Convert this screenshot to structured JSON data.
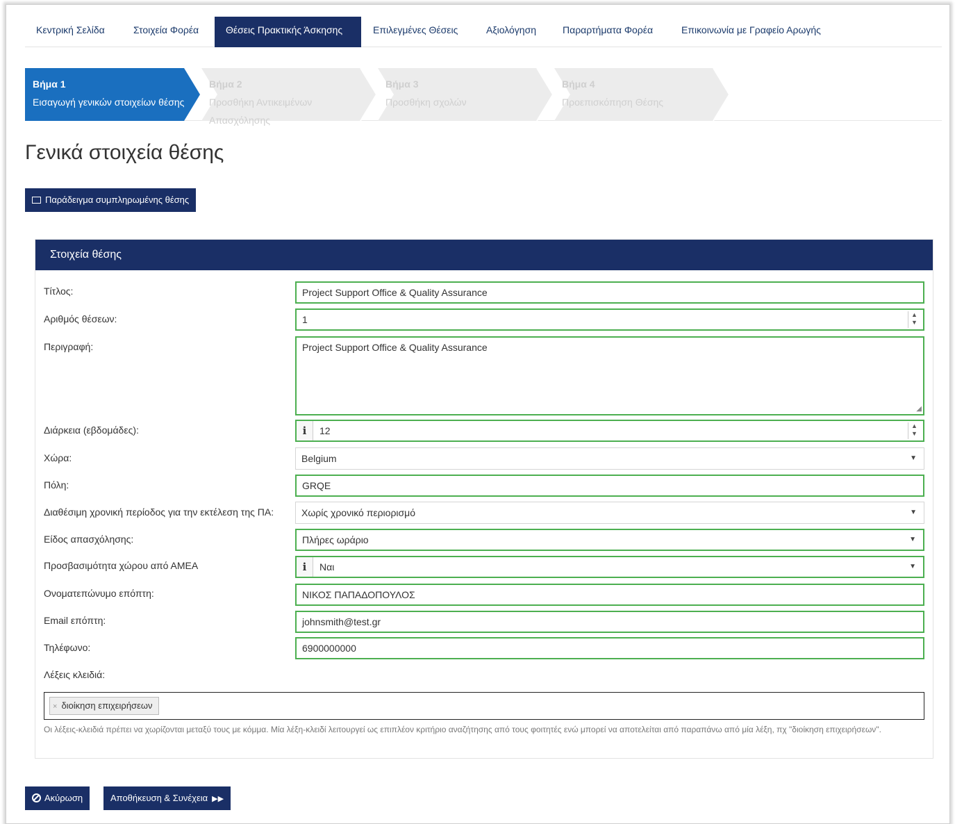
{
  "nav": {
    "items": [
      {
        "label": "Κεντρική Σελίδα"
      },
      {
        "label": "Στοιχεία Φορέα"
      },
      {
        "label": "Θέσεις Πρακτικής Άσκησης"
      },
      {
        "label": "Επιλεγμένες Θέσεις"
      },
      {
        "label": "Αξιολόγηση"
      },
      {
        "label": "Παραρτήματα Φορέα"
      },
      {
        "label": "Επικοινωνία με Γραφείο Αρωγής"
      }
    ],
    "active_index": 2
  },
  "steps": [
    {
      "title": "Βήμα 1",
      "subtitle": "Εισαγωγή γενικών στοιχείων θέσης",
      "subtitle2": ""
    },
    {
      "title": "Βήμα 2",
      "subtitle": "Προσθήκη Αντικειμένων",
      "subtitle2": "Απασχόλησης"
    },
    {
      "title": "Βήμα 3",
      "subtitle": "Προσθήκη σχολών",
      "subtitle2": ""
    },
    {
      "title": "Βήμα 4",
      "subtitle": "Προεπισκόπηση Θέσης",
      "subtitle2": ""
    }
  ],
  "page_title": "Γενικά στοιχεία θέσης",
  "example_button": "Παράδειγμα συμπληρωμένης θέσης",
  "panel_title": "Στοιχεία θέσης",
  "form": {
    "title": {
      "label": "Τίτλος:",
      "value": "Project Support Office & Quality Assurance"
    },
    "positions": {
      "label": "Αριθμός θέσεων:",
      "value": "1"
    },
    "description": {
      "label": "Περιγραφή:",
      "value": "Project Support Office & Quality Assurance"
    },
    "duration": {
      "label": "Διάρκεια (εβδομάδες):",
      "value": "12"
    },
    "country": {
      "label": "Χώρα:",
      "value": "Belgium"
    },
    "city": {
      "label": "Πόλη:",
      "value": "GRQE"
    },
    "period": {
      "label": "Διαθέσιμη χρονική περίοδος για την εκτέλεση της ΠΑ:",
      "value": "Χωρίς χρονικό περιορισμό"
    },
    "employment": {
      "label": "Είδος απασχόλησης:",
      "value": "Πλήρες ωράριο"
    },
    "accessibility": {
      "label": "Προσβασιμότητα χώρου από ΑΜΕΑ",
      "value": "Ναι"
    },
    "supervisor": {
      "label": "Ονοματεπώνυμο επόπτη:",
      "value": "ΝΙΚΟΣ ΠΑΠΑΔΟΠΟΥΛΟΣ"
    },
    "supervisor_email": {
      "label": "Email επόπτη:",
      "value": "johnsmith@test.gr"
    },
    "phone": {
      "label": "Τηλέφωνο:",
      "value": "6900000000"
    },
    "keywords": {
      "label": "Λέξεις κλειδιά:",
      "tags": [
        "διοίκηση επιχειρήσεων"
      ],
      "help": "Οι λέξεις-κλειδιά πρέπει να χωρίζονται μεταξύ τους με κόμμα. Μία λέξη-κλειδί λειτουργεί ως επιπλέον κριτήριο αναζήτησης από τους φοιτητές ενώ μπορεί να αποτελείται από παραπάνω από μία λέξη, πχ \"διοίκηση επιχειρήσεων\"."
    }
  },
  "buttons": {
    "cancel": "Ακύρωση",
    "save_continue": "Αποθήκευση & Συνέχεια"
  },
  "icons": {
    "info": "i",
    "remove": "×",
    "caret": "▼"
  },
  "colors": {
    "primary": "#1a2f66",
    "active_step": "#1a6fbf",
    "valid_border": "#4caf50"
  }
}
